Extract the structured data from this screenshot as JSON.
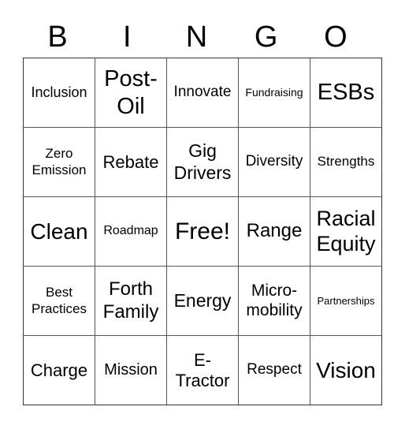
{
  "header": {
    "letters": [
      "B",
      "I",
      "N",
      "G",
      "O"
    ]
  },
  "card": {
    "rows": [
      [
        {
          "text": "Inclusion",
          "size": 18
        },
        {
          "text": "Post-Oil",
          "size": 29
        },
        {
          "text": "Innovate",
          "size": 19
        },
        {
          "text": "Fundraising",
          "size": 14
        },
        {
          "text": "ESBs",
          "size": 29
        }
      ],
      [
        {
          "text": "Zero Emission",
          "size": 17
        },
        {
          "text": "Rebate",
          "size": 22
        },
        {
          "text": "Gig Drivers",
          "size": 23
        },
        {
          "text": "Diversity",
          "size": 19
        },
        {
          "text": "Strengths",
          "size": 17
        }
      ],
      [
        {
          "text": "Clean",
          "size": 28
        },
        {
          "text": "Roadmap",
          "size": 16
        },
        {
          "text": "Free!",
          "size": 30
        },
        {
          "text": "Range",
          "size": 24
        },
        {
          "text": "Racial Equity",
          "size": 27
        }
      ],
      [
        {
          "text": "Best Practices",
          "size": 17
        },
        {
          "text": "Forth Family",
          "size": 24
        },
        {
          "text": "Energy",
          "size": 23
        },
        {
          "text": "Micro-mobility",
          "size": 21
        },
        {
          "text": "Partnerships",
          "size": 13
        }
      ],
      [
        {
          "text": "Charge",
          "size": 22
        },
        {
          "text": "Mission",
          "size": 20
        },
        {
          "text": "E-Tractor",
          "size": 22
        },
        {
          "text": "Respect",
          "size": 19
        },
        {
          "text": "Vision",
          "size": 28
        }
      ]
    ]
  }
}
